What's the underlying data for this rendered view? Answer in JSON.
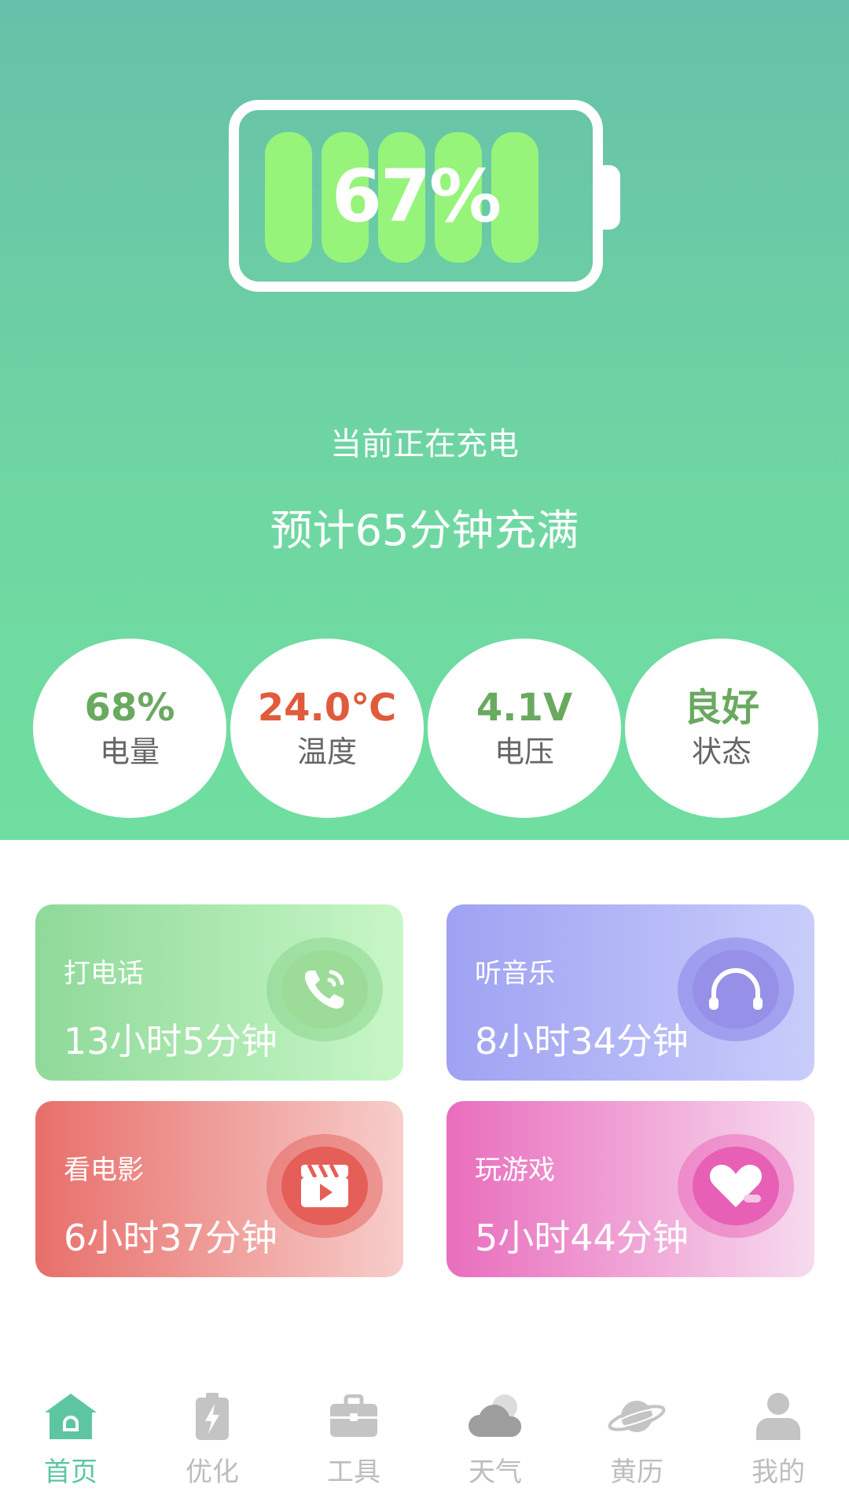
{
  "battery": {
    "percent_text": "67%",
    "level": 0.67
  },
  "charging": {
    "status": "当前正在充电",
    "estimate": "预计65分钟充满"
  },
  "stats": [
    {
      "value": "68%",
      "label": "电量",
      "color": "#6aa960"
    },
    {
      "value": "24.0℃",
      "label": "温度",
      "color": "#e05a3c"
    },
    {
      "value": "4.1V",
      "label": "电压",
      "color": "#6aa960"
    },
    {
      "value": "良好",
      "label": "状态",
      "color": "#6aa960"
    }
  ],
  "usage": [
    {
      "title": "打电话",
      "time": "13小时5分钟",
      "icon": "phone-icon"
    },
    {
      "title": "听音乐",
      "time": "8小时34分钟",
      "icon": "headphones-icon"
    },
    {
      "title": "看电影",
      "time": "6小时37分钟",
      "icon": "clapperboard-icon"
    },
    {
      "title": "玩游戏",
      "time": "5小时44分钟",
      "icon": "heart-icon"
    }
  ],
  "nav": [
    {
      "label": "首页",
      "icon": "home-icon",
      "active": true
    },
    {
      "label": "优化",
      "icon": "battery-bolt-icon"
    },
    {
      "label": "工具",
      "icon": "toolbox-icon"
    },
    {
      "label": "天气",
      "icon": "cloud-icon"
    },
    {
      "label": "黄历",
      "icon": "planet-icon"
    },
    {
      "label": "我的",
      "icon": "user-icon"
    }
  ],
  "colors": {
    "accent": "#5dc6a1",
    "hero_top": "#67c0a9",
    "hero_bottom": "#6fdea0",
    "battery_cell": "#96f47a",
    "nav_inactive": "#bdbdbd"
  }
}
